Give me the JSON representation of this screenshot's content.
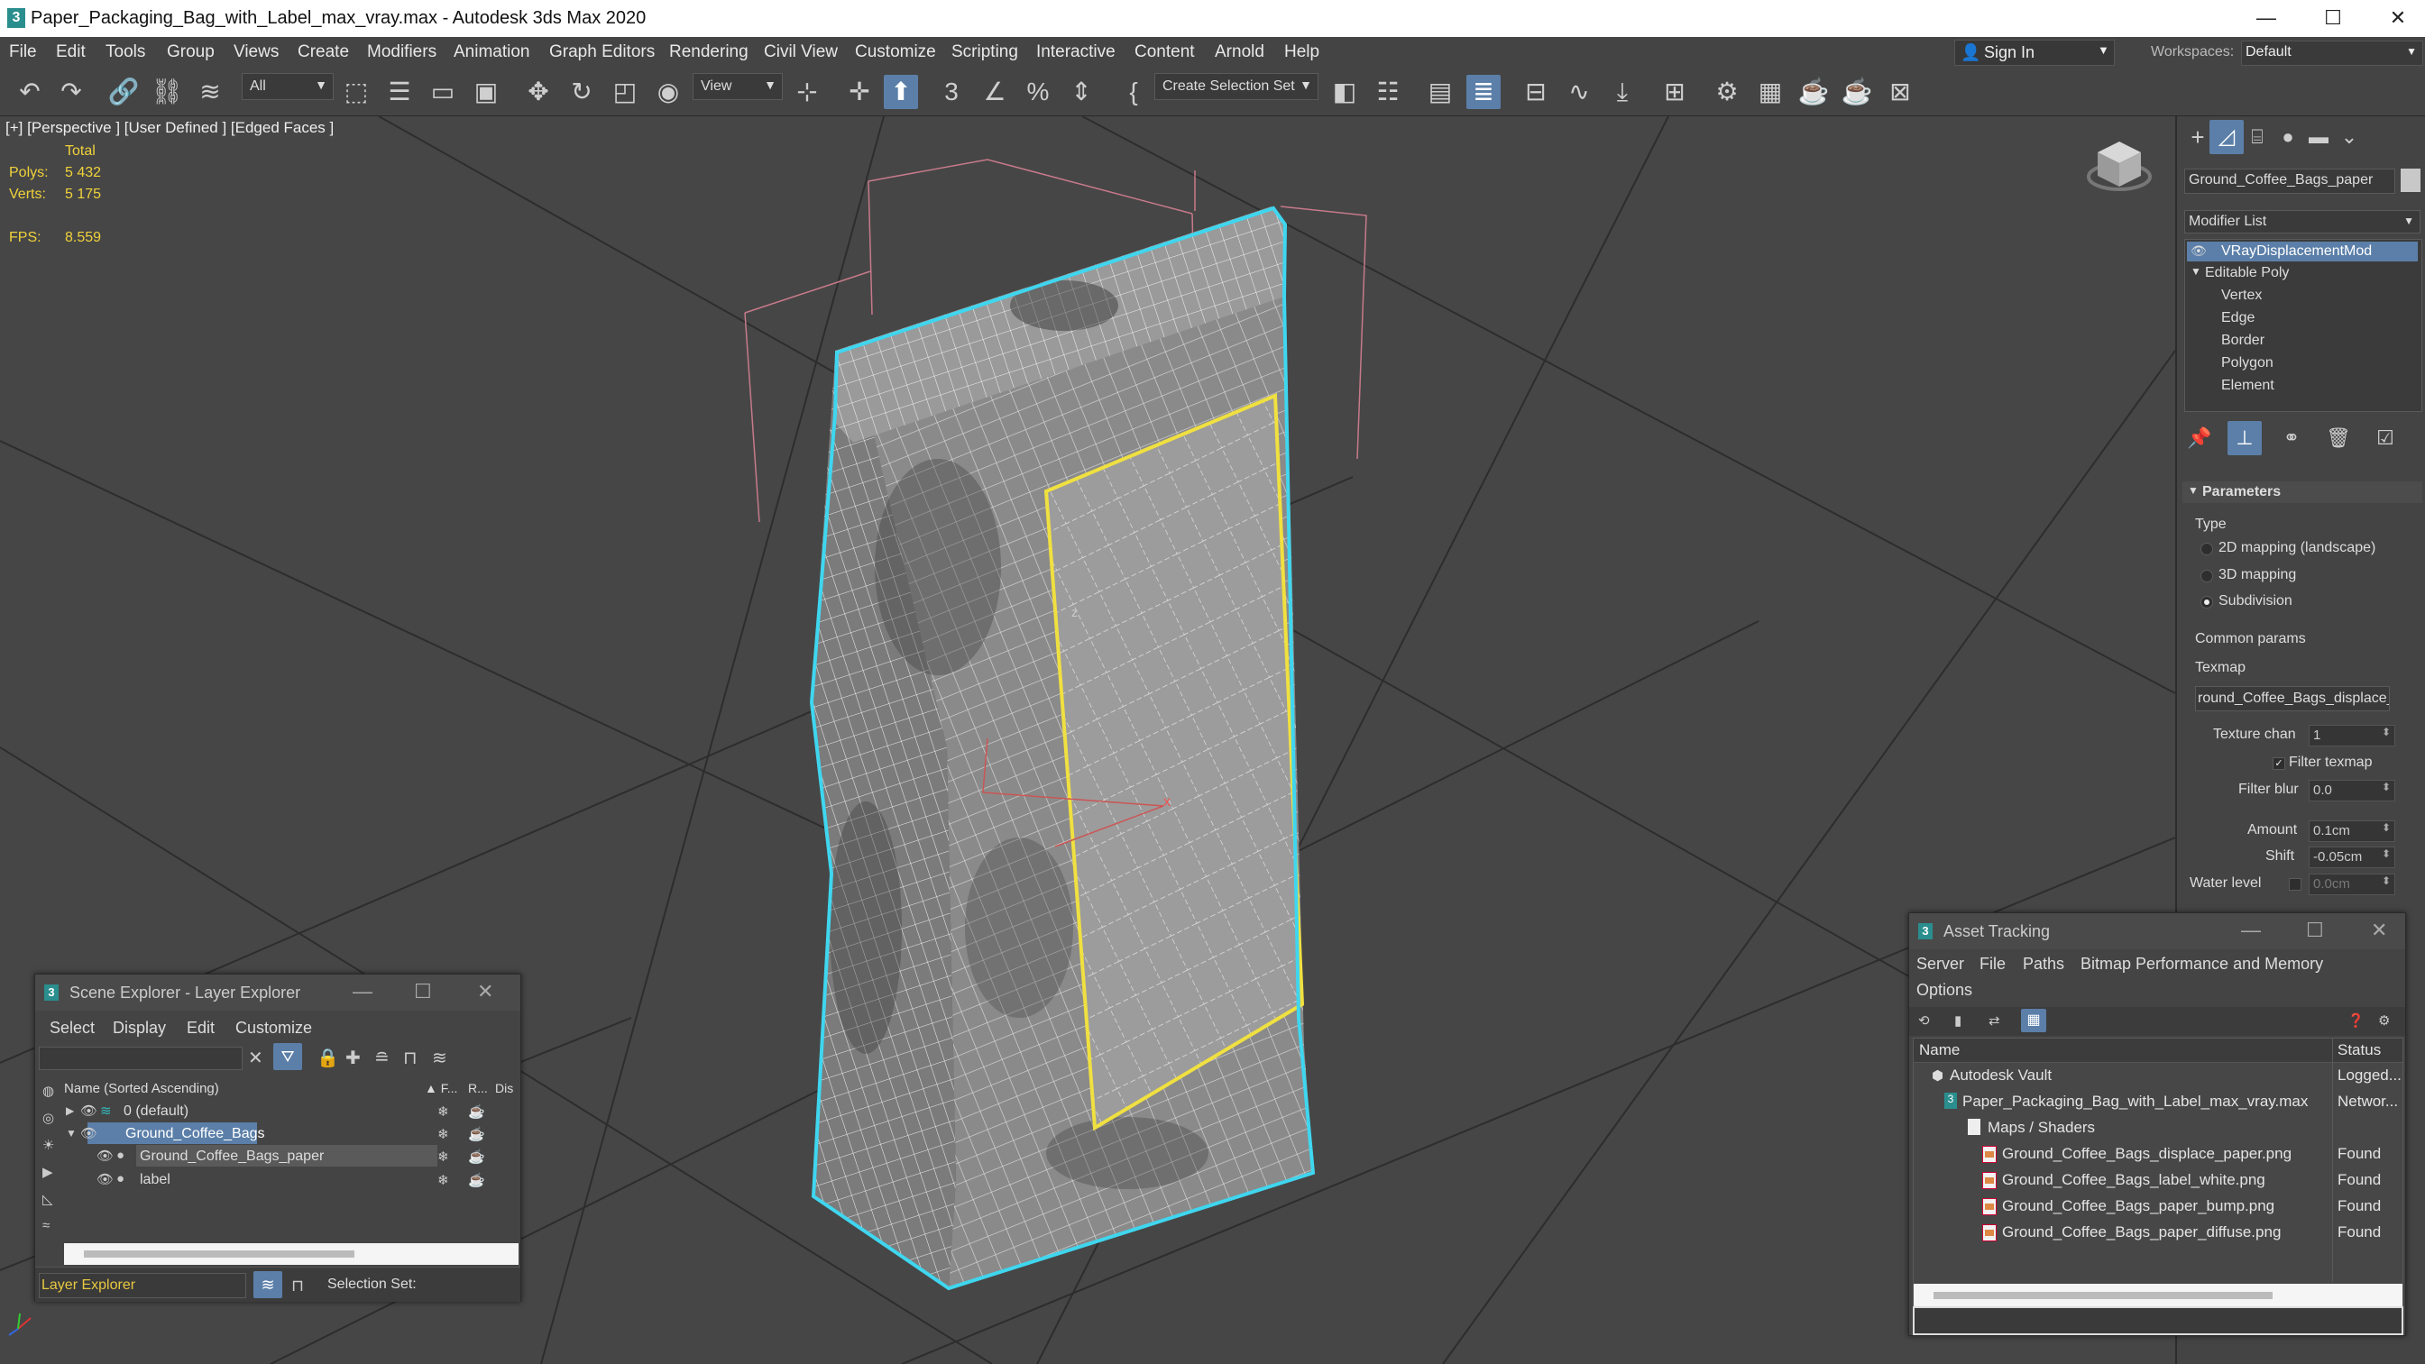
{
  "app": {
    "title": "Paper_Packaging_Bag_with_Label_max_vray.max - Autodesk 3ds Max 2020",
    "icon_glyph": "3"
  },
  "window_controls": {
    "minimize": "—",
    "maximize": "☐",
    "close": "✕"
  },
  "menu": {
    "items": [
      "File",
      "Edit",
      "Tools",
      "Group",
      "Views",
      "Create",
      "Modifiers",
      "Animation",
      "Graph Editors",
      "Rendering",
      "Civil View",
      "Customize",
      "Scripting",
      "Interactive",
      "Content",
      "Arnold",
      "Help"
    ],
    "sign_in": "Sign In",
    "workspaces_label": "Workspaces:",
    "workspace_value": "Default"
  },
  "toolbar": {
    "filter_value": "All",
    "refcoord_value": "View",
    "selection_set_placeholder": "Create Selection Set"
  },
  "viewport": {
    "label": "[+] [Perspective ] [User Defined ] [Edged Faces ]",
    "stats": {
      "total_label": "Total",
      "polys_label": "Polys:",
      "polys_value": "5 432",
      "verts_label": "Verts:",
      "verts_value": "5 175",
      "fps_label": "FPS:",
      "fps_value": "8.559"
    },
    "gizmo_x": "x",
    "gizmo_z": "z"
  },
  "command_panel": {
    "object_name": "Ground_Coffee_Bags_paper",
    "object_color": "#c8c8c8",
    "modifier_list_label": "Modifier List",
    "stack": [
      {
        "label": "VRayDisplacementMod",
        "selected": true
      },
      {
        "label": "Editable Poly",
        "selected": false
      },
      {
        "label": "Vertex",
        "selected": false
      },
      {
        "label": "Edge",
        "selected": false
      },
      {
        "label": "Border",
        "selected": false
      },
      {
        "label": "Polygon",
        "selected": false
      },
      {
        "label": "Element",
        "selected": false
      }
    ],
    "parameters": {
      "rollout_title": "Parameters",
      "type_label": "Type",
      "type_options": [
        "2D mapping (landscape)",
        "3D mapping",
        "Subdivision"
      ],
      "type_selected": "Subdivision",
      "common_params": "Common params",
      "texmap_label": "Texmap",
      "texmap_value": "round_Coffee_Bags_displace_",
      "texture_chan_label": "Texture chan",
      "texture_chan_value": "1",
      "filter_texmap_label": "Filter texmap",
      "filter_blur_label": "Filter blur",
      "filter_blur_value": "0.0",
      "amount_label": "Amount",
      "amount_value": "0.1cm",
      "shift_label": "Shift",
      "shift_value": "-0.05cm",
      "water_level_label": "Water level",
      "water_level_value": "0.0cm"
    }
  },
  "scene_explorer": {
    "title": "Scene Explorer - Layer Explorer",
    "menu": [
      "Select",
      "Display",
      "Edit",
      "Customize"
    ],
    "columns": {
      "name": "Name (Sorted Ascending)",
      "frozen": "▲ F...",
      "render": "R...",
      "display": "Dis"
    },
    "rows": [
      {
        "label": "0 (default)",
        "level": 0,
        "expanded": false,
        "selected": false
      },
      {
        "label": "Ground_Coffee_Bags",
        "level": 0,
        "expanded": true,
        "selected": true
      },
      {
        "label": "Ground_Coffee_Bags_paper",
        "level": 1,
        "expanded": false,
        "selected": true
      },
      {
        "label": "label",
        "level": 1,
        "expanded": false,
        "selected": false
      }
    ],
    "footer_explorer": "Layer Explorer",
    "footer_selection_set": "Selection Set:"
  },
  "asset_tracking": {
    "title": "Asset Tracking",
    "menu": [
      "Server",
      "File",
      "Paths",
      "Bitmap Performance and Memory"
    ],
    "menu_row2": [
      "Options"
    ],
    "columns": {
      "name": "Name",
      "status": "Status"
    },
    "rows": [
      {
        "name": "Autodesk Vault",
        "status": "Logged...",
        "level": 0,
        "icon": "vault"
      },
      {
        "name": "Paper_Packaging_Bag_with_Label_max_vray.max",
        "status": "Networ...",
        "level": 1,
        "icon": "max"
      },
      {
        "name": "Maps / Shaders",
        "status": "",
        "level": 2,
        "icon": "folder"
      },
      {
        "name": "Ground_Coffee_Bags_displace_paper.png",
        "status": "Found",
        "level": 3,
        "icon": "png"
      },
      {
        "name": "Ground_Coffee_Bags_label_white.png",
        "status": "Found",
        "level": 3,
        "icon": "png"
      },
      {
        "name": "Ground_Coffee_Bags_paper_bump.png",
        "status": "Found",
        "level": 3,
        "icon": "png"
      },
      {
        "name": "Ground_Coffee_Bags_paper_diffuse.png",
        "status": "Found",
        "level": 3,
        "icon": "png"
      }
    ]
  },
  "colors": {
    "selection_outline": "#3fd6ef",
    "label_outline": "#f0e040",
    "stats_text": "#f0d23a",
    "active_button": "#5b7fa8"
  }
}
